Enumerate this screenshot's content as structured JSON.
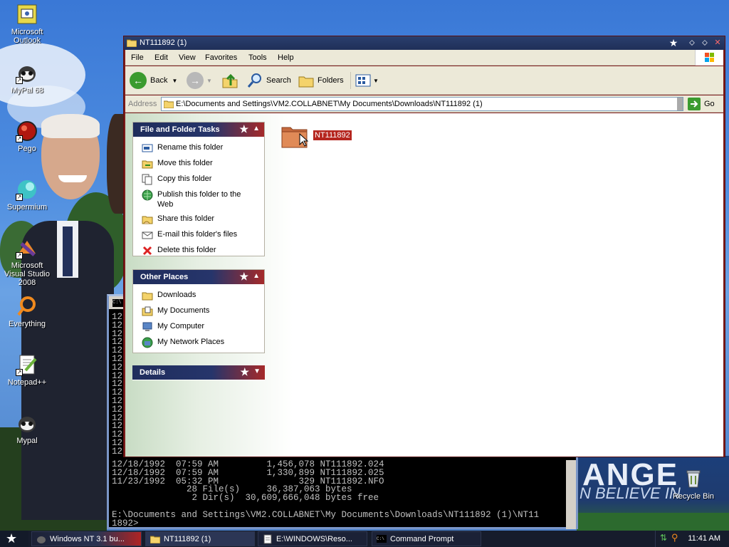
{
  "desktop": {
    "icons": [
      {
        "label": "Microsoft Outlook",
        "icon": "outlook-icon"
      },
      {
        "label": "MyPal 68",
        "icon": "mypal-icon"
      },
      {
        "label": "Pego",
        "icon": "pego-icon"
      },
      {
        "label": "Supermium",
        "icon": "supermium-icon"
      },
      {
        "label": "Microsoft Visual Studio 2008",
        "icon": "visual-studio-icon"
      },
      {
        "label": "Everything",
        "icon": "everything-icon"
      },
      {
        "label": "Notepad++",
        "icon": "notepadpp-icon"
      },
      {
        "label": "Mypal",
        "icon": "mypal-icon"
      }
    ],
    "recycle_bin": "Recycle Bin",
    "wallpaper_text": {
      "big": "ANGE",
      "small": "N BELIEVE IN"
    }
  },
  "command_prompt": {
    "lines_top": [
      "12",
      "12",
      "12",
      "12",
      "12",
      "12",
      "12",
      "12",
      "12",
      "12",
      "12",
      "12",
      "12",
      "12",
      "12",
      "12",
      "12"
    ],
    "listing": [
      "12/18/1992  07:59 AM         1,456,078 NT111892.024",
      "12/18/1992  07:59 AM         1,330,899 NT111892.025",
      "11/23/1992  05:32 PM               329 NT111892.NFO",
      "              28 File(s)     36,387,063 bytes",
      "               2 Dir(s)  30,609,666,048 bytes free",
      "",
      "E:\\Documents and Settings\\VM2.COLLABNET\\My Documents\\Downloads\\NT111892 (1)\\NT11",
      "1892>"
    ]
  },
  "explorer": {
    "title": "NT111892 (1)",
    "menu": [
      "File",
      "Edit",
      "View",
      "Favorites",
      "Tools",
      "Help"
    ],
    "toolbar": {
      "back": "Back",
      "search": "Search",
      "folders": "Folders"
    },
    "address_label": "Address",
    "address_value": "E:\\Documents and Settings\\VM2.COLLABNET\\My Documents\\Downloads\\NT111892 (1)",
    "go_label": "Go",
    "file_tasks": {
      "title": "File and Folder Tasks",
      "items": [
        {
          "label": "Rename this folder",
          "icon": "rename-icon"
        },
        {
          "label": "Move this folder",
          "icon": "move-icon"
        },
        {
          "label": "Copy this folder",
          "icon": "copy-icon"
        },
        {
          "label": "Publish this folder to the Web",
          "icon": "publish-web-icon"
        },
        {
          "label": "Share this folder",
          "icon": "share-icon"
        },
        {
          "label": "E-mail this folder's files",
          "icon": "email-icon"
        },
        {
          "label": "Delete this folder",
          "icon": "delete-icon"
        }
      ]
    },
    "other_places": {
      "title": "Other Places",
      "items": [
        {
          "label": "Downloads",
          "icon": "folder-icon"
        },
        {
          "label": "My Documents",
          "icon": "my-documents-icon"
        },
        {
          "label": "My Computer",
          "icon": "my-computer-icon"
        },
        {
          "label": "My Network Places",
          "icon": "network-places-icon"
        }
      ]
    },
    "details": {
      "title": "Details"
    },
    "folder": {
      "name": "NT111892"
    }
  },
  "taskbar": {
    "buttons": [
      "Windows NT 3.1 bu...",
      "NT111892 (1)",
      "E:\\WINDOWS\\Reso...",
      "Command Prompt"
    ],
    "clock": "11:41 AM"
  }
}
